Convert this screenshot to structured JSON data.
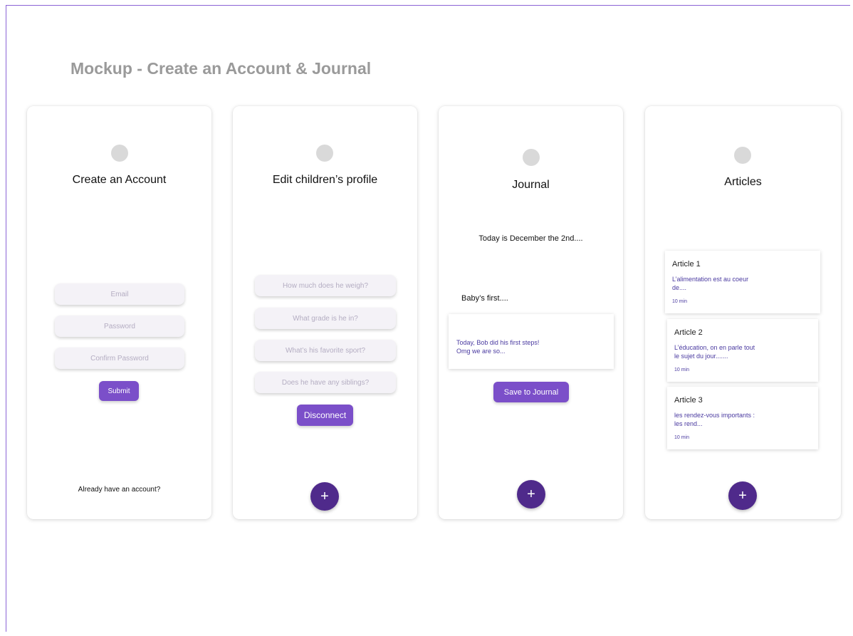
{
  "page_title": "Mockup - Create an Account & Journal",
  "colors": {
    "frame": "#8b63d6",
    "button": "#7b4fc9",
    "fab": "#4f2a8b",
    "link_text": "#4a3aa0"
  },
  "create_account": {
    "title": "Create an Account",
    "email_placeholder": "Email",
    "password_placeholder": "Password",
    "confirm_placeholder": "Confirm Password",
    "submit": "Submit",
    "footer": "Already have an account?"
  },
  "edit_profile": {
    "title": "Edit children’s profile",
    "q1": "How much does he weigh?",
    "q2": "What grade is he in?",
    "q3": "What’s his favorite sport?",
    "q4": "Does he have any siblings?",
    "disconnect": "Disconnect",
    "fab": "+"
  },
  "journal": {
    "title": "Journal",
    "date_text": "Today is December the 2nd....",
    "entry_title": "Baby’s first....",
    "entry_body": "Today, Bob did his first steps! Omg we are so...",
    "save": "Save to Journal",
    "fab": "+"
  },
  "articles": {
    "title": "Articles",
    "items": [
      {
        "title": "Article 1",
        "desc": "L’alimentation est au coeur de....",
        "time": "10 min"
      },
      {
        "title": "Article 2",
        "desc": "L’éducation, on en parle tout le sujet du jour.......",
        "time": "10 min"
      },
      {
        "title": "Article 3",
        "desc": "les rendez-vous importants : les rend...",
        "time": "10 min"
      }
    ],
    "fab": "+"
  }
}
